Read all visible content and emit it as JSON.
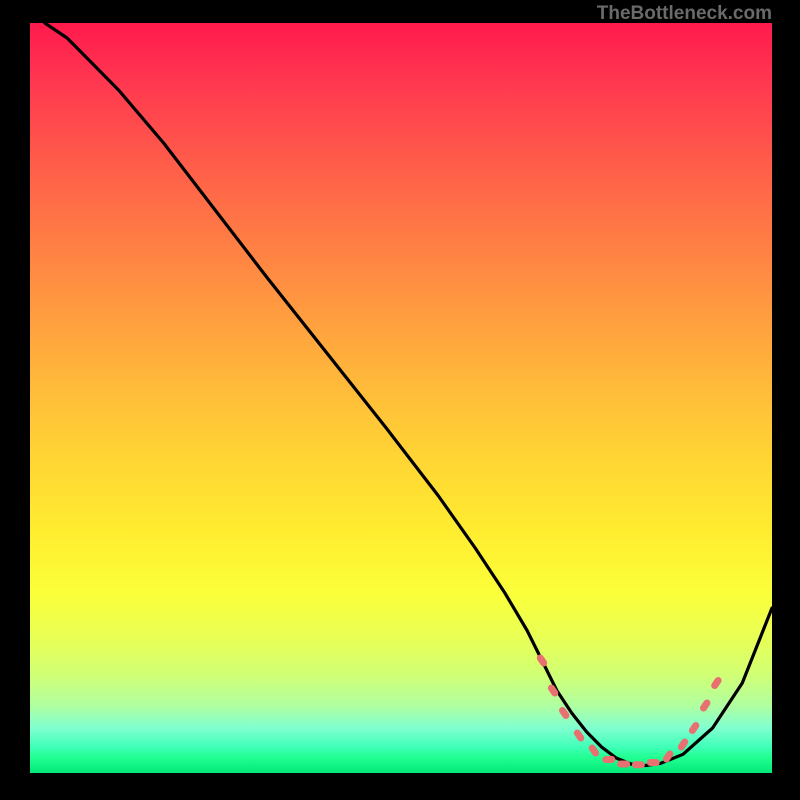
{
  "watermark": "TheBottleneck.com",
  "chart_data": {
    "type": "line",
    "title": "",
    "xlabel": "",
    "ylabel": "",
    "xlim": [
      0,
      100
    ],
    "ylim": [
      0,
      100
    ],
    "series": [
      {
        "name": "curve",
        "x": [
          2,
          5,
          8,
          12,
          18,
          25,
          32,
          40,
          48,
          55,
          60,
          64,
          67,
          69,
          71,
          73,
          75,
          77,
          79,
          81,
          83,
          85,
          88,
          92,
          96,
          100
        ],
        "y": [
          100,
          98,
          95,
          91,
          84,
          75,
          66,
          56,
          46,
          37,
          30,
          24,
          19,
          15,
          11,
          8,
          5.5,
          3.5,
          2,
          1.2,
          1.0,
          1.3,
          2.5,
          6,
          12,
          22
        ]
      }
    ],
    "markers": {
      "name": "dotted-salmon",
      "color": "#e87070",
      "points": [
        {
          "x": 69,
          "y": 15
        },
        {
          "x": 70.5,
          "y": 11
        },
        {
          "x": 72,
          "y": 8
        },
        {
          "x": 74,
          "y": 5
        },
        {
          "x": 76,
          "y": 3
        },
        {
          "x": 78,
          "y": 1.8
        },
        {
          "x": 80,
          "y": 1.2
        },
        {
          "x": 82,
          "y": 1.1
        },
        {
          "x": 84,
          "y": 1.4
        },
        {
          "x": 86,
          "y": 2.2
        },
        {
          "x": 88,
          "y": 3.8
        },
        {
          "x": 89.5,
          "y": 6
        },
        {
          "x": 91,
          "y": 9
        },
        {
          "x": 92.5,
          "y": 12
        }
      ]
    }
  }
}
